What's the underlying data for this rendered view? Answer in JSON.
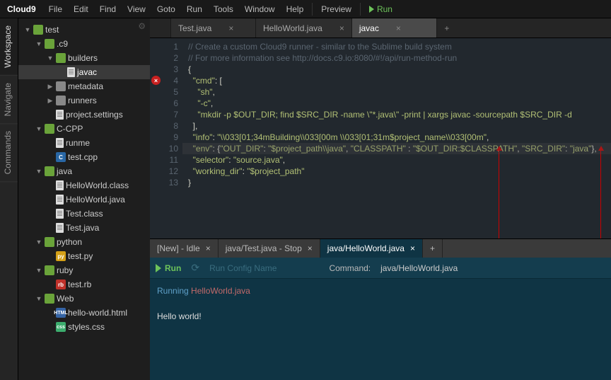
{
  "menubar": {
    "logo": "Cloud9",
    "items": [
      "File",
      "Edit",
      "Find",
      "View",
      "Goto",
      "Run",
      "Tools",
      "Window",
      "Help"
    ],
    "preview": "Preview",
    "run": "Run"
  },
  "lefttabs": [
    "Workspace",
    "Navigate",
    "Commands"
  ],
  "tree": [
    {
      "depth": 0,
      "arrow": "open",
      "ico": "folder-green",
      "label": "test"
    },
    {
      "depth": 1,
      "arrow": "open",
      "ico": "folder-green",
      "label": ".c9"
    },
    {
      "depth": 2,
      "arrow": "open",
      "ico": "folder-green",
      "label": "builders"
    },
    {
      "depth": 3,
      "arrow": "",
      "ico": "file-white",
      "label": "javac",
      "selected": true
    },
    {
      "depth": 2,
      "arrow": "closed",
      "ico": "folder-gray",
      "label": "metadata"
    },
    {
      "depth": 2,
      "arrow": "closed",
      "ico": "folder-gray",
      "label": "runners"
    },
    {
      "depth": 2,
      "arrow": "",
      "ico": "file-white",
      "label": "project.settings"
    },
    {
      "depth": 1,
      "arrow": "open",
      "ico": "folder-green",
      "label": "C-CPP"
    },
    {
      "depth": 2,
      "arrow": "",
      "ico": "file-white",
      "label": "runme"
    },
    {
      "depth": 2,
      "arrow": "",
      "ico": "cpp",
      "icoText": "C",
      "label": "test.cpp"
    },
    {
      "depth": 1,
      "arrow": "open",
      "ico": "folder-green",
      "label": "java"
    },
    {
      "depth": 2,
      "arrow": "",
      "ico": "file-white",
      "label": "HelloWorld.class"
    },
    {
      "depth": 2,
      "arrow": "",
      "ico": "file-white",
      "label": "HelloWorld.java"
    },
    {
      "depth": 2,
      "arrow": "",
      "ico": "file-white",
      "label": "Test.class"
    },
    {
      "depth": 2,
      "arrow": "",
      "ico": "file-white",
      "label": "Test.java"
    },
    {
      "depth": 1,
      "arrow": "open",
      "ico": "folder-green",
      "label": "python"
    },
    {
      "depth": 2,
      "arrow": "",
      "ico": "py",
      "icoText": "py",
      "label": "test.py"
    },
    {
      "depth": 1,
      "arrow": "open",
      "ico": "folder-green",
      "label": "ruby"
    },
    {
      "depth": 2,
      "arrow": "",
      "ico": "rb",
      "icoText": "rb",
      "label": "test.rb"
    },
    {
      "depth": 1,
      "arrow": "open",
      "ico": "folder-green",
      "label": "Web"
    },
    {
      "depth": 2,
      "arrow": "",
      "ico": "html",
      "icoText": "HTML",
      "label": "hello-world.html"
    },
    {
      "depth": 2,
      "arrow": "",
      "ico": "css",
      "icoText": "css",
      "label": "styles.css"
    }
  ],
  "editor": {
    "tabs": [
      {
        "label": "Test.java",
        "active": false
      },
      {
        "label": "HelloWorld.java",
        "active": false
      },
      {
        "label": "javac",
        "active": true
      }
    ],
    "lines": [
      {
        "n": 1,
        "html": "<span class='c-comm'>// Create a custom Cloud9 runner - similar to the Sublime build system</span>"
      },
      {
        "n": 2,
        "html": "<span class='c-comm'>// For more information see http://docs.c9.io:8080/#!/api/run-method-run</span>"
      },
      {
        "n": 3,
        "html": "<span class='c-pun'>{</span>"
      },
      {
        "n": 4,
        "err": true,
        "html": "  <span class='c-str'>\"cmd\"</span><span class='c-pun'>: [</span>"
      },
      {
        "n": 5,
        "html": "    <span class='c-str'>\"sh\"</span><span class='c-pun'>,</span>"
      },
      {
        "n": 6,
        "html": "    <span class='c-str'>\"-c\"</span><span class='c-pun'>,</span>"
      },
      {
        "n": 7,
        "html": "    <span class='c-str'>\"mkdir -p $OUT_DIR; find $SRC_DIR -name \\\"*.java\\\" -print | xargs javac -sourcepath $SRC_DIR -d</span>"
      },
      {
        "n": 8,
        "html": "  <span class='c-pun'>],</span>"
      },
      {
        "n": 9,
        "html": "  <span class='c-str'>\"info\"</span><span class='c-pun'>: </span><span class='c-str'>\"\\\\033[01;34mBuilding\\\\033[00m \\\\033[01;31m$project_name\\\\033[00m\"</span><span class='c-pun'>,</span>"
      },
      {
        "n": 10,
        "hl": true,
        "html": "  <span class='c-str'>\"env\"</span><span class='c-pun'>: {</span><span class='c-str'>\"OUT_DIR\"</span><span class='c-pun'>: </span><span class='c-str'>\"$project_path\\\\java\"</span><span class='c-pun'>, </span><span class='c-str'>\"CLASSPATH\"</span><span class='c-pun'> : </span><span class='c-str'>\"$OUT_DIR:$CLASSPATH\"</span><span class='c-pun'>, </span><span class='c-str'>\"SRC_DIR\"</span><span class='c-pun'>: </span><span class='c-str'>\"java\"</span><span class='c-pun'>},</span>"
      },
      {
        "n": 11,
        "html": "  <span class='c-str'>\"selector\"</span><span class='c-pun'>: </span><span class='c-str'>\"source.java\"</span><span class='c-pun'>,</span>"
      },
      {
        "n": 12,
        "html": "  <span class='c-str'>\"working_dir\"</span><span class='c-pun'>: </span><span class='c-str'>\"$project_path\"</span>"
      },
      {
        "n": 13,
        "html": "<span class='c-pun'>}</span>"
      }
    ]
  },
  "bottom": {
    "tabs": [
      {
        "label": "[New] - Idle",
        "active": false
      },
      {
        "label": "java/Test.java - Stop",
        "active": false
      },
      {
        "label": "java/HelloWorld.java",
        "active": true
      }
    ],
    "run": "Run",
    "cfg_placeholder": "Run Config Name",
    "cmd_label": "Command:",
    "cmd_value": "java/HelloWorld.java",
    "console": {
      "line1": {
        "w2": "Running",
        "w3": "HelloWorld.java"
      },
      "line3": "Hello world!"
    }
  }
}
